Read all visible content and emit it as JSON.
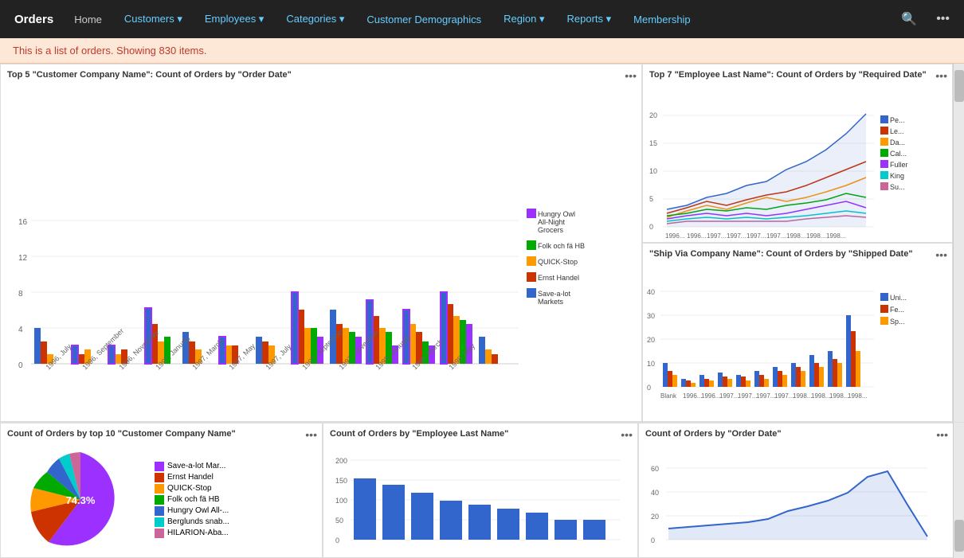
{
  "navbar": {
    "brand": "Orders",
    "items": [
      {
        "label": "Home",
        "active": false,
        "dropdown": false
      },
      {
        "label": "Customers",
        "active": true,
        "dropdown": true
      },
      {
        "label": "Employees",
        "active": false,
        "dropdown": true
      },
      {
        "label": "Categories",
        "active": false,
        "dropdown": true
      },
      {
        "label": "Customer Demographics",
        "active": false,
        "dropdown": false
      },
      {
        "label": "Region",
        "active": false,
        "dropdown": true
      },
      {
        "label": "Reports",
        "active": false,
        "dropdown": true
      },
      {
        "label": "Membership",
        "active": false,
        "dropdown": false
      }
    ]
  },
  "alert": {
    "text": "This is a list of orders. Showing 830 items."
  },
  "charts": {
    "main_bar": {
      "title": "Top 5 \"Customer Company Name\": Count of Orders by \"Order Date\"",
      "legend": [
        {
          "label": "Hungry Owl All-Night Grocers",
          "color": "#9b30ff"
        },
        {
          "label": "Folk och fä HB",
          "color": "#00aa00"
        },
        {
          "label": "QUICK-Stop",
          "color": "#ff9900"
        },
        {
          "label": "Ernst Handel",
          "color": "#cc3300"
        },
        {
          "label": "Save-a-lot Markets",
          "color": "#3366cc"
        }
      ]
    },
    "top_right_line": {
      "title": "Top 7 \"Employee Last Name\": Count of Orders by \"Required Date\"",
      "legend": [
        {
          "label": "Pe...",
          "color": "#3366cc"
        },
        {
          "label": "Le...",
          "color": "#cc3300"
        },
        {
          "label": "Da...",
          "color": "#ff9900"
        },
        {
          "label": "Cal...",
          "color": "#00aa00"
        },
        {
          "label": "Fuller",
          "color": "#9b30ff"
        },
        {
          "label": "King",
          "color": "#00cccc"
        },
        {
          "label": "Su...",
          "color": "#cc6699"
        }
      ]
    },
    "mid_right_bar": {
      "title": "\"Ship Via Company Name\": Count of Orders by \"Shipped Date\"",
      "legend": [
        {
          "label": "Uni...",
          "color": "#3366cc"
        },
        {
          "label": "Fe...",
          "color": "#cc3300"
        },
        {
          "label": "Sp...",
          "color": "#ff9900"
        }
      ]
    },
    "bottom_pie": {
      "title": "Count of Orders by top 10 \"Customer Company Name\"",
      "percent": "74.3%",
      "legend": [
        {
          "label": "Save-a-lot Mar...",
          "color": "#9b30ff"
        },
        {
          "label": "Ernst Handel",
          "color": "#cc3300"
        },
        {
          "label": "QUICK-Stop",
          "color": "#ff9900"
        },
        {
          "label": "Folk och fä HB",
          "color": "#00aa00"
        },
        {
          "label": "Hungry Owl All-...",
          "color": "#3366cc"
        },
        {
          "label": "Berglunds snab...",
          "color": "#00cccc"
        },
        {
          "label": "HILARION-Aba...",
          "color": "#cc6699"
        }
      ]
    },
    "bottom_bar": {
      "title": "Count of Orders by \"Employee Last Name\""
    },
    "bottom_line": {
      "title": "Count of Orders by \"Order Date\""
    }
  }
}
